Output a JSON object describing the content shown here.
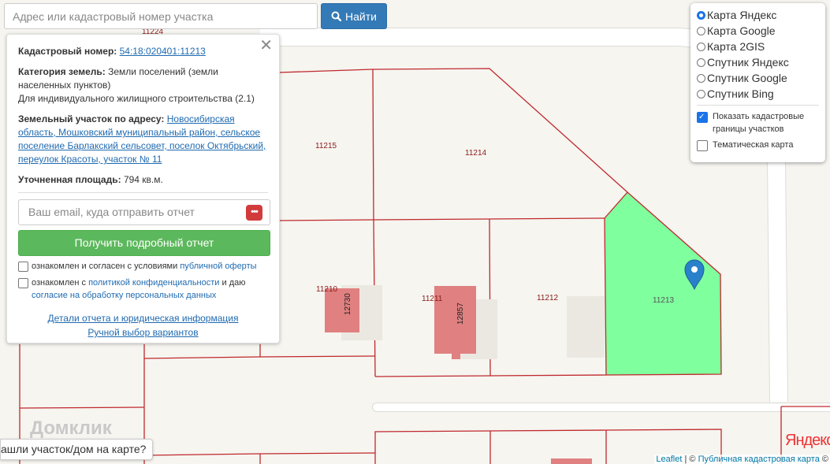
{
  "search": {
    "placeholder": "Адрес или кадастровый номер участка",
    "button_label": "Найти"
  },
  "info": {
    "cadastral_label": "Кадастровый номер:",
    "cadastral_value": "54:18:020401:11213",
    "category_label": "Категория земель:",
    "category_value": "Земли поселений (земли населенных пунктов)",
    "usage": "Для индивидуального жилищного строительства (2.1)",
    "address_label": "Земельный участок по адресу:",
    "address_value": "Новосибирская область, Мошковский муниципальный район, сельское поселение Барлакский сельсовет, поселок Октябрьский, переулок Красоты, участок № 11",
    "area_label": "Уточненная площадь:",
    "area_value": "794 кв.м.",
    "email_placeholder": "Ваш email, куда отправить отчет",
    "get_report_label": "Получить подробный отчет",
    "consent1_text": "ознакомлен и согласен с условиями",
    "consent1_link": "публичной оферты",
    "consent2_text": "ознакомлен с",
    "consent2_link": "политикой конфиденциальности",
    "consent2_mid": "и даю",
    "consent2_link2": "согласие на обработку персональных данных",
    "details_link": "Детали отчета и юридическая информация",
    "manual_link": "Ручной выбор вариантов"
  },
  "layers": {
    "options": [
      "Карта Яндекс",
      "Карта Google",
      "Карта 2GIS",
      "Спутник Яндекс",
      "Спутник Google",
      "Спутник Bing"
    ],
    "selected_index": 0,
    "show_boundaries_label": "Показать кадастровые границы участков",
    "show_boundaries_checked": true,
    "thematic_label": "Тематическая карта",
    "thematic_checked": false
  },
  "map": {
    "parcel_labels": [
      "11224",
      "11215",
      "11214",
      "11210",
      "11211",
      "11212",
      "11213"
    ],
    "building_labels": [
      "12730",
      "12857"
    ],
    "highlight_color": "#80ff9f",
    "boundary_color": "#c0282d"
  },
  "bottom_tip": "ашли участок/дом на карте?",
  "attribution": {
    "leaflet": "Leaflet",
    "sep": "|",
    "copy1": "©",
    "cadastre": "Публичная кадастровая карта",
    "copy2": "©"
  },
  "watermarks": {
    "yandex": "Яндекс",
    "domclick": "Домклик"
  }
}
